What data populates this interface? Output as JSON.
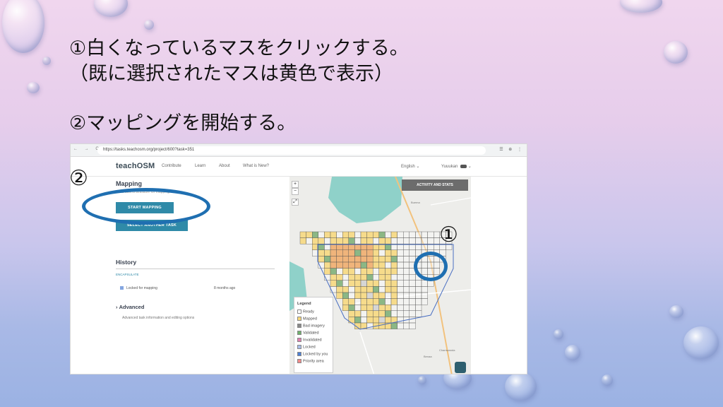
{
  "slide": {
    "line1": "①白くなっているマスをクリックする。",
    "line2": "（既に選択されたマスは黄色で表示）",
    "line3": "②マッピングを開始する。",
    "marker_map": "①",
    "marker_button": "②"
  },
  "browser": {
    "nav_buttons": "← → C",
    "url": "https://tasks.teachosm.org/project/600?task=351",
    "toolbar_icons": "☰ ⊕ ⋮"
  },
  "app_nav": {
    "logo": "teachOSM",
    "links": [
      "Contribute",
      "Learn",
      "About",
      "What is New?"
    ],
    "language": "English",
    "user": "Yuuukan"
  },
  "task_panel": {
    "title": "Mapping",
    "note": "This task is available for mapping",
    "start_button": "START MAPPING",
    "select_button": "SELECT ANOTHER TASK",
    "history_title": "History",
    "history_link": "ENCAPSULATE",
    "history_item": "Locked for mapping",
    "history_time": "8 months ago",
    "advanced_title": "Advanced",
    "advanced_desc": "Advanced task information and editing options"
  },
  "map": {
    "zoom_in": "+",
    "zoom_out": "−",
    "fullscreen": "⤢",
    "activity_button": "ACTIVITY AND STATS",
    "labels": [
      "Buema",
      "Chamwanda",
      "Benaa"
    ],
    "legend_title": "Legend",
    "legend": [
      {
        "label": "Ready",
        "color": "#ffffff"
      },
      {
        "label": "Mapped",
        "color": "#f7d77a"
      },
      {
        "label": "Bad imagery",
        "color": "#888888"
      },
      {
        "label": "Validated",
        "color": "#6fb06c"
      },
      {
        "label": "Invalidated",
        "color": "#e07eb0"
      },
      {
        "label": "Locked",
        "color": "#a9bde8"
      },
      {
        "label": "Locked by you",
        "color": "#4b7fd4"
      },
      {
        "label": "Priority area",
        "color": "#f08a8a"
      }
    ]
  },
  "colors": {
    "accent_button": "#2f8aa8",
    "annotation_circle": "#1f6fb1",
    "water": "#8fd1c9",
    "mapped": "#f7d77a",
    "priority": "#f0a055"
  }
}
